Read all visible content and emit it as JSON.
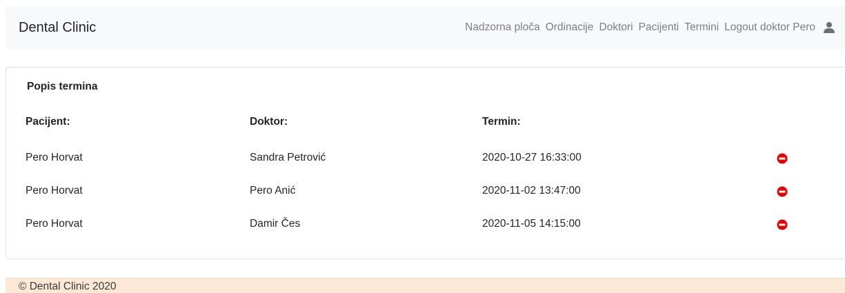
{
  "navbar": {
    "brand": "Dental Clinic",
    "links": [
      {
        "label": "Nadzorna ploča"
      },
      {
        "label": "Ordinacije"
      },
      {
        "label": "Doktori"
      },
      {
        "label": "Pacijenti"
      },
      {
        "label": "Termini"
      },
      {
        "label": "Logout doktor Pero"
      }
    ],
    "user_icon": "user-icon"
  },
  "card": {
    "title": "Popis termina",
    "headers": {
      "patient": "Pacijent:",
      "doctor": "Doktor:",
      "appointment": "Termin:"
    },
    "rows": [
      {
        "patient": "Pero Horvat",
        "doctor": "Sandra Petrović",
        "appointment": "2020-10-27 16:33:00",
        "action_icon": "minus-circle-icon"
      },
      {
        "patient": "Pero Horvat",
        "doctor": "Pero Anić",
        "appointment": "2020-11-02 13:47:00",
        "action_icon": "minus-circle-icon"
      },
      {
        "patient": "Pero Horvat",
        "doctor": "Damir Čes",
        "appointment": "2020-11-05 14:15:00",
        "action_icon": "minus-circle-icon"
      }
    ]
  },
  "footer": {
    "text": "© Dental Clinic 2020"
  },
  "colors": {
    "navbar_bg": "#f8f9fa",
    "footer_bg": "#fbe9d6",
    "delete_red": "#e60000",
    "nav_link": "#7b7f84"
  }
}
